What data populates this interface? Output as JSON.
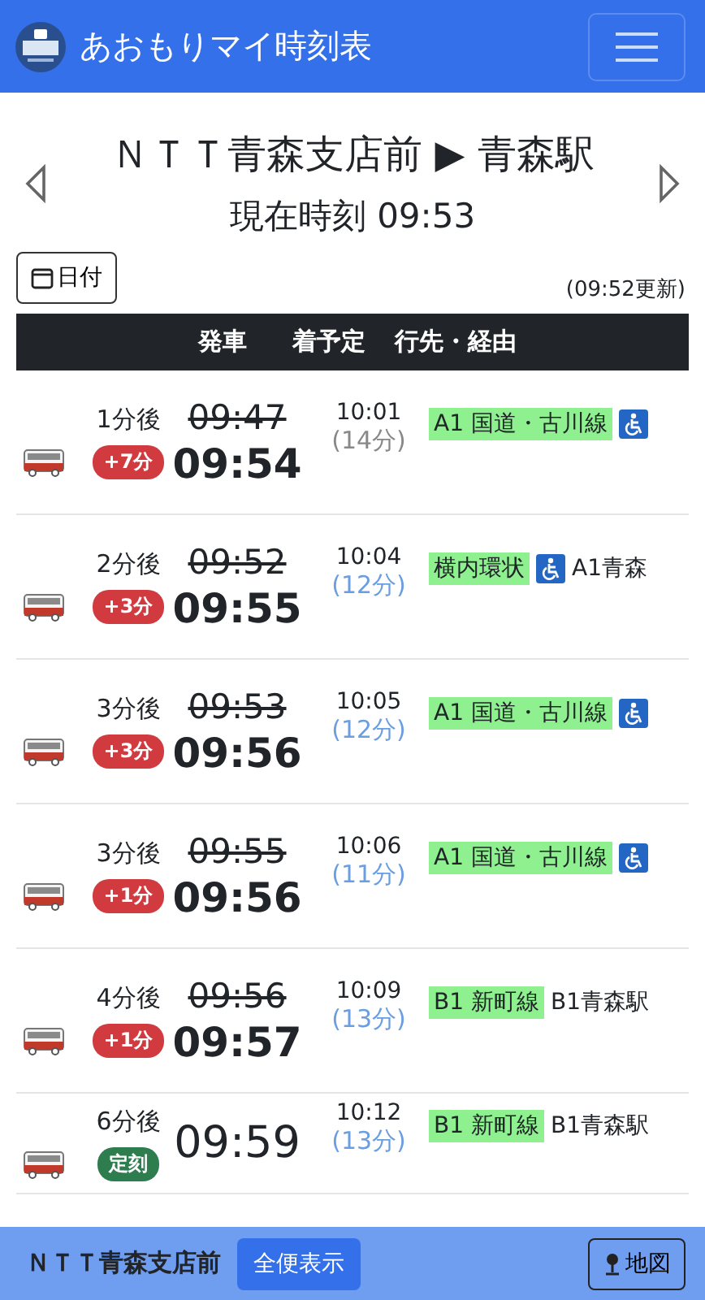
{
  "app_bar": {
    "title": "あおもりマイ時刻表"
  },
  "heading": {
    "route": "ＮＴＴ青森支店前 ▶ 青森駅",
    "current_time": "現在時刻 09:53"
  },
  "date_button": "日付",
  "updated": "(09:52更新)",
  "table": {
    "columns": [
      "発車",
      "着予定",
      "行先・経由"
    ],
    "rows": [
      {
        "wait": "1分後",
        "scheduled": "09:47",
        "departure": "09:54",
        "delay": {
          "kind": "late",
          "label": "+7分"
        },
        "arrival": "10:01",
        "duration": "(14分)",
        "realtime": false,
        "route": "A1 国道・古川線",
        "accessible": true
      },
      {
        "wait": "2分後",
        "scheduled": "09:52",
        "departure": "09:55",
        "delay": {
          "kind": "late",
          "label": "+3分"
        },
        "arrival": "10:04",
        "duration": "(12分)",
        "realtime": true,
        "route": "横内環状",
        "accessible": true,
        "destination": "A1青森"
      },
      {
        "wait": "3分後",
        "scheduled": "09:53",
        "departure": "09:56",
        "delay": {
          "kind": "late",
          "label": "+3分"
        },
        "arrival": "10:05",
        "duration": "(12分)",
        "realtime": true,
        "route": "A1 国道・古川線",
        "accessible": true
      },
      {
        "wait": "3分後",
        "scheduled": "09:55",
        "departure": "09:56",
        "delay": {
          "kind": "late",
          "label": "+1分"
        },
        "arrival": "10:06",
        "duration": "(11分)",
        "realtime": true,
        "route": "A1 国道・古川線",
        "accessible": true
      },
      {
        "wait": "4分後",
        "scheduled": "09:56",
        "departure": "09:57",
        "delay": {
          "kind": "late",
          "label": "+1分"
        },
        "arrival": "10:09",
        "duration": "(13分)",
        "realtime": true,
        "route": "B1 新町線",
        "accessible": false,
        "destination": "B1青森駅"
      },
      {
        "wait": "6分後",
        "departure": "09:59",
        "delay": {
          "kind": "ontime",
          "label": "定刻"
        },
        "arrival": "10:12",
        "duration": "(13分)",
        "realtime": true,
        "route": "B1 新町線",
        "accessible": false,
        "destination": "B1青森駅"
      }
    ]
  },
  "footer": {
    "stop": "ＮＴＴ青森支店前",
    "all_button": "全便表示",
    "map_button": "地図"
  }
}
